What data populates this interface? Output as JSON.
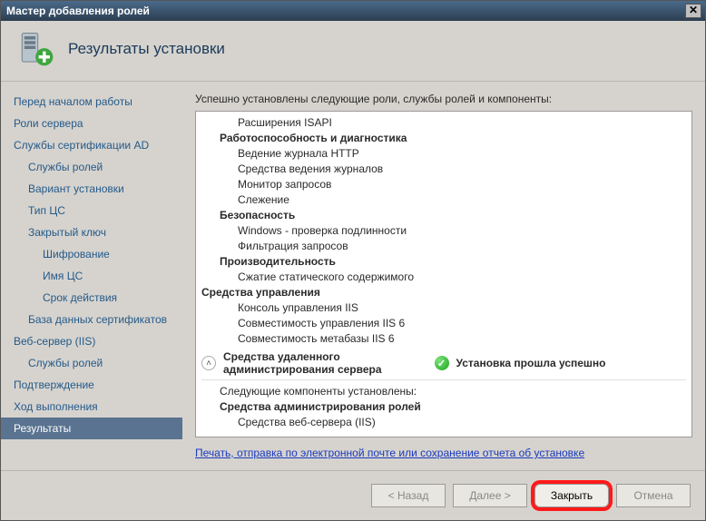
{
  "titlebar": {
    "title": "Мастер добавления ролей"
  },
  "header": {
    "title": "Результаты установки"
  },
  "sidebar": {
    "items": [
      {
        "label": "Перед началом работы",
        "indent": 0
      },
      {
        "label": "Роли сервера",
        "indent": 0
      },
      {
        "label": "Службы сертификации AD",
        "indent": 0
      },
      {
        "label": "Службы ролей",
        "indent": 1
      },
      {
        "label": "Вариант установки",
        "indent": 1
      },
      {
        "label": "Тип ЦС",
        "indent": 1
      },
      {
        "label": "Закрытый ключ",
        "indent": 1
      },
      {
        "label": "Шифрование",
        "indent": 2
      },
      {
        "label": "Имя ЦС",
        "indent": 2
      },
      {
        "label": "Срок действия",
        "indent": 2
      },
      {
        "label": "База данных сертификатов",
        "indent": 1
      },
      {
        "label": "Веб-сервер (IIS)",
        "indent": 0
      },
      {
        "label": "Службы ролей",
        "indent": 1
      },
      {
        "label": "Подтверждение",
        "indent": 0
      },
      {
        "label": "Ход выполнения",
        "indent": 0
      },
      {
        "label": "Результаты",
        "indent": 0,
        "selected": true
      }
    ]
  },
  "main": {
    "intro": "Успешно установлены следующие роли, службы ролей и компоненты:",
    "tree": [
      {
        "level": 2,
        "text": "Расширения ISAPI"
      },
      {
        "level": 1,
        "text": "Работоспособность и диагностика"
      },
      {
        "level": 2,
        "text": "Ведение журнала HTTP"
      },
      {
        "level": 2,
        "text": "Средства ведения журналов"
      },
      {
        "level": 2,
        "text": "Монитор запросов"
      },
      {
        "level": 2,
        "text": "Слежение"
      },
      {
        "level": 1,
        "text": "Безопасность"
      },
      {
        "level": 2,
        "text": "Windows - проверка подлинности"
      },
      {
        "level": 2,
        "text": "Фильтрация запросов"
      },
      {
        "level": 1,
        "text": "Производительность"
      },
      {
        "level": 2,
        "text": "Сжатие статического содержимого"
      },
      {
        "level": 0,
        "text": "Средства управления"
      },
      {
        "level": 2,
        "text": "Консоль управления IIS"
      },
      {
        "level": 2,
        "text": "Совместимость управления IIS 6"
      },
      {
        "level": 2,
        "text": "Совместимость метабазы IIS 6"
      }
    ],
    "status": {
      "title_line1": "Средства удаленного",
      "title_line2": "администрирования сервера",
      "ok_text": "Установка прошла успешно"
    },
    "post": {
      "intro": "Следующие компоненты установлены:",
      "heading": "Средства администрирования ролей",
      "item": "Средства веб-сервера (IIS)"
    },
    "link": "Печать, отправка по электронной почте или сохранение отчета об установке"
  },
  "footer": {
    "back": "< Назад",
    "next": "Далее >",
    "close": "Закрыть",
    "cancel": "Отмена"
  }
}
